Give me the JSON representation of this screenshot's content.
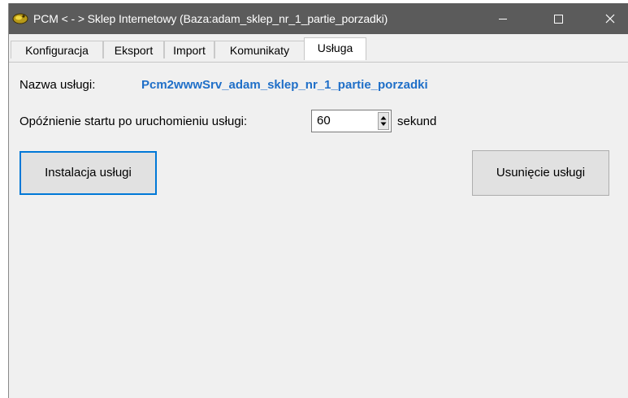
{
  "window": {
    "title": "PCM  < - > Sklep Internetowy (Baza:adam_sklep_nr_1_partie_porzadki)",
    "icons": [
      "app-logo-icon",
      "minimize-icon",
      "maximize-icon",
      "close-icon"
    ]
  },
  "tabs": [
    {
      "label": "Konfiguracja"
    },
    {
      "label": "Eksport"
    },
    {
      "label": "Import"
    },
    {
      "label": "Komunikaty"
    },
    {
      "label": "Usługa",
      "active": true
    }
  ],
  "service": {
    "name_label": "Nazwa usługi:",
    "name_value": "Pcm2wwwSrv_adam_sklep_nr_1_partie_porzadki",
    "delay_label": "Opóźnienie startu po uruchomieniu usługi:",
    "delay_value": "60",
    "delay_unit": "sekund",
    "install_button": "Instalacja usługi",
    "remove_button": "Usunięcie usługi"
  },
  "colors": {
    "titlebar": "#5b5b5b",
    "link": "#1f6fc8",
    "focus_border": "#0078d7"
  }
}
